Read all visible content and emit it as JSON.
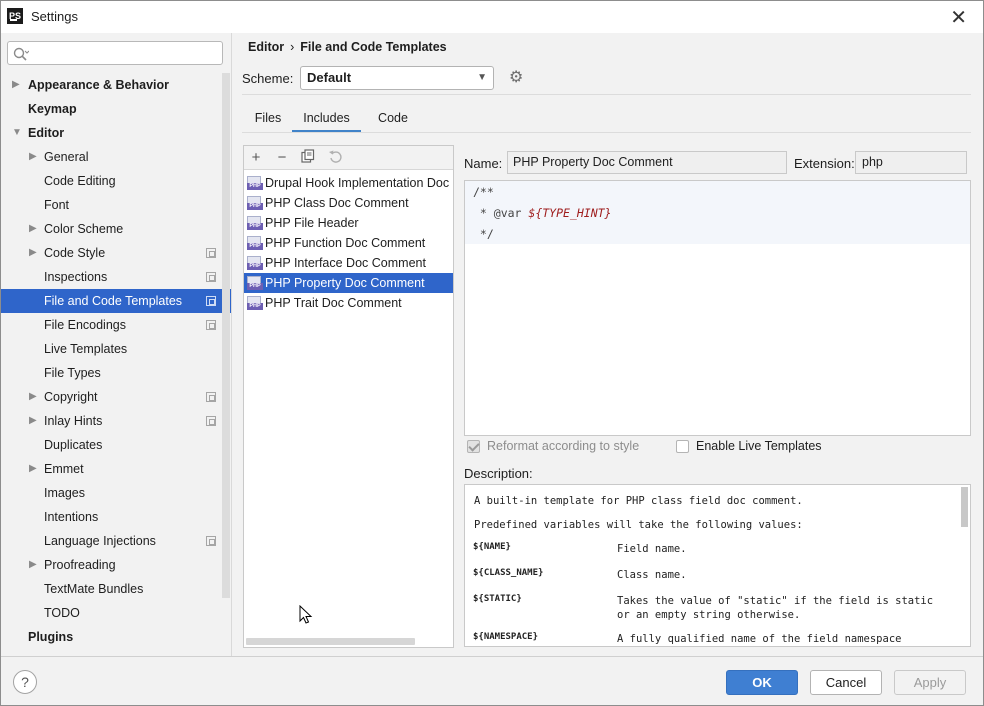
{
  "window": {
    "title": "Settings",
    "app_icon": "PS"
  },
  "sidebar": {
    "search_placeholder": "",
    "items": [
      {
        "label": "Appearance & Behavior",
        "level": 0,
        "arrow": "▶"
      },
      {
        "label": "Keymap",
        "level": 0
      },
      {
        "label": "Editor",
        "level": 0,
        "arrow": "▼"
      },
      {
        "label": "General",
        "level": 1,
        "arrow": "▶"
      },
      {
        "label": "Code Editing",
        "level": 1
      },
      {
        "label": "Font",
        "level": 1
      },
      {
        "label": "Color Scheme",
        "level": 1,
        "arrow": "▶"
      },
      {
        "label": "Code Style",
        "level": 1,
        "arrow": "▶",
        "project": true
      },
      {
        "label": "Inspections",
        "level": 1,
        "project": true
      },
      {
        "label": "File and Code Templates",
        "level": 1,
        "project": true,
        "selected": true
      },
      {
        "label": "File Encodings",
        "level": 1,
        "project": true
      },
      {
        "label": "Live Templates",
        "level": 1
      },
      {
        "label": "File Types",
        "level": 1
      },
      {
        "label": "Copyright",
        "level": 1,
        "arrow": "▶",
        "project": true
      },
      {
        "label": "Inlay Hints",
        "level": 1,
        "arrow": "▶",
        "project": true
      },
      {
        "label": "Duplicates",
        "level": 1
      },
      {
        "label": "Emmet",
        "level": 1,
        "arrow": "▶"
      },
      {
        "label": "Images",
        "level": 1
      },
      {
        "label": "Intentions",
        "level": 1
      },
      {
        "label": "Language Injections",
        "level": 1,
        "project": true
      },
      {
        "label": "Proofreading",
        "level": 1,
        "arrow": "▶"
      },
      {
        "label": "TextMate Bundles",
        "level": 1
      },
      {
        "label": "TODO",
        "level": 1
      },
      {
        "label": "Plugins",
        "level": 0
      }
    ]
  },
  "header": {
    "breadcrumb_parent": "Editor",
    "breadcrumb_sep": "›",
    "breadcrumb_current": "File and Code Templates"
  },
  "scheme": {
    "label": "Scheme:",
    "value": "Default",
    "dropdown_icon": "▼",
    "gear_icon": "⚙"
  },
  "tabs": [
    {
      "label": "Files"
    },
    {
      "label": "Includes",
      "active": true
    },
    {
      "label": "Code"
    }
  ],
  "toolbar": {
    "add": "+",
    "remove": "−",
    "copy": "copy-icon",
    "reset": "undo-icon"
  },
  "templates": [
    {
      "label": "Drupal Hook Implementation Doc Comment"
    },
    {
      "label": "PHP Class Doc Comment"
    },
    {
      "label": "PHP File Header"
    },
    {
      "label": "PHP Function Doc Comment"
    },
    {
      "label": "PHP Interface Doc Comment"
    },
    {
      "label": "PHP Property Doc Comment",
      "selected": true
    },
    {
      "label": "PHP Trait Doc Comment"
    }
  ],
  "php_icon_text": "PHP",
  "editor": {
    "name_label": "Name:",
    "name_value": "PHP Property Doc Comment",
    "extension_label": "Extension:",
    "extension_value": "php",
    "line1": "/**",
    "line2_prefix": " * @var ",
    "line2_var": "${TYPE_HINT}",
    "line3": " */"
  },
  "options": {
    "reformat_label": "Reformat according to style",
    "reformat_checked": true,
    "live_templates_label": "Enable Live Templates",
    "live_templates_checked": false
  },
  "description": {
    "label": "Description:",
    "intro": "A built-in template for PHP class field doc comment.",
    "predefined": "Predefined variables will take the following values:",
    "vars": [
      {
        "name": "${NAME}",
        "desc": "Field name."
      },
      {
        "name": "${CLASS_NAME}",
        "desc": "Class name."
      },
      {
        "name": "${STATIC}",
        "desc": "Takes the value of \"static\" if the field is static or an empty string otherwise."
      },
      {
        "name": "${NAMESPACE}",
        "desc": "A fully qualified name of the field namespace without a"
      }
    ]
  },
  "buttons": {
    "help": "?",
    "ok": "OK",
    "cancel": "Cancel",
    "apply": "Apply"
  },
  "colors": {
    "accent": "#2f65ca",
    "primary_button": "#3f7fd2",
    "template_var": "#9e1c1c"
  }
}
